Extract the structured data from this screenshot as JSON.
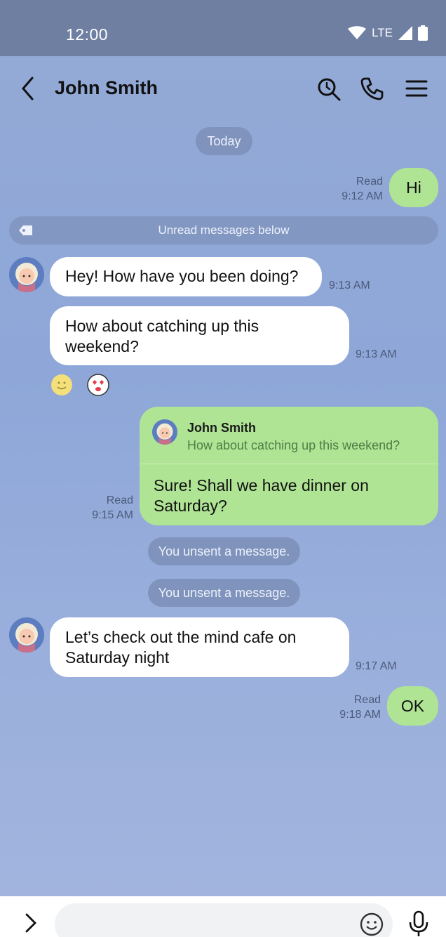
{
  "status": {
    "time": "12:00",
    "network": "LTE"
  },
  "header": {
    "title": "John Smith"
  },
  "chat": {
    "date_chip": "Today",
    "unread_divider": "Unread messages below",
    "m1": {
      "text": "Hi",
      "read": "Read",
      "time": "9:12 AM"
    },
    "m2": {
      "text": "Hey! How have you been doing?",
      "time": "9:13 AM"
    },
    "m3": {
      "line1": "How about catching up this",
      "line2": "weekend?",
      "time": "9:13 AM"
    },
    "m4": {
      "reply_name": "John Smith",
      "reply_text": "How about catching up this weekend?",
      "line1": "Sure! Shall we have dinner on",
      "line2": "Saturday?",
      "read": "Read",
      "time": "9:15 AM"
    },
    "unsent1": "You unsent a message.",
    "unsent2": "You unsent a message.",
    "m5": {
      "line1": "Let’s check out the mind cafe on",
      "line2": "Saturday night",
      "time": "9:17 AM"
    },
    "m6": {
      "text": "OK",
      "read": "Read",
      "time": "9:18 AM"
    }
  },
  "colors": {
    "background": "#8ea7d8",
    "outgoing_bubble": "#b0e495",
    "incoming_bubble": "#ffffff",
    "status_bar": "#6f7fa2"
  },
  "icons": [
    "back-icon",
    "search-icon",
    "phone-icon",
    "menu-icon",
    "tag-icon",
    "smile-reaction-icon",
    "heart-eyes-reaction-icon",
    "expand-icon",
    "emoji-icon",
    "mic-icon",
    "wifi-icon",
    "signal-icon",
    "battery-icon"
  ]
}
